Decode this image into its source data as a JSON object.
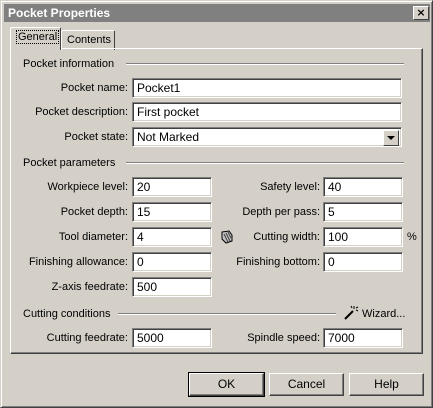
{
  "window": {
    "title": "Pocket Properties",
    "close_glyph": "×"
  },
  "tabs": [
    {
      "label": "General",
      "active": true
    },
    {
      "label": "Contents",
      "active": false
    }
  ],
  "pocket_info": {
    "section": "Pocket information",
    "name_label": "Pocket name:",
    "name_value": "Pocket1",
    "desc_label": "Pocket description:",
    "desc_value": "First pocket",
    "state_label": "Pocket state:",
    "state_value": "Not Marked"
  },
  "pocket_params": {
    "section": "Pocket parameters",
    "workpiece_level_label": "Workpiece level:",
    "workpiece_level_value": "20",
    "safety_level_label": "Safety level:",
    "safety_level_value": "40",
    "pocket_depth_label": "Pocket depth:",
    "pocket_depth_value": "15",
    "depth_per_pass_label": "Depth per pass:",
    "depth_per_pass_value": "5",
    "tool_diameter_label": "Tool diameter:",
    "tool_diameter_value": "4",
    "cutting_width_label": "Cutting width:",
    "cutting_width_value": "100",
    "cutting_width_unit": "%",
    "finishing_allowance_label": "Finishing allowance:",
    "finishing_allowance_value": "0",
    "finishing_bottom_label": "Finishing bottom:",
    "finishing_bottom_value": "0",
    "z_feedrate_label": "Z-axis feedrate:",
    "z_feedrate_value": "500"
  },
  "cutting_conditions": {
    "section": "Cutting conditions",
    "wizard_label": "Wizard...",
    "cutting_feedrate_label": "Cutting feedrate:",
    "cutting_feedrate_value": "5000",
    "spindle_speed_label": "Spindle speed:",
    "spindle_speed_value": "7000"
  },
  "buttons": {
    "ok": "OK",
    "cancel": "Cancel",
    "help": "Help"
  },
  "icons": {
    "tool": "tool-diameter-icon",
    "wizard": "wizard-wand-icon"
  }
}
